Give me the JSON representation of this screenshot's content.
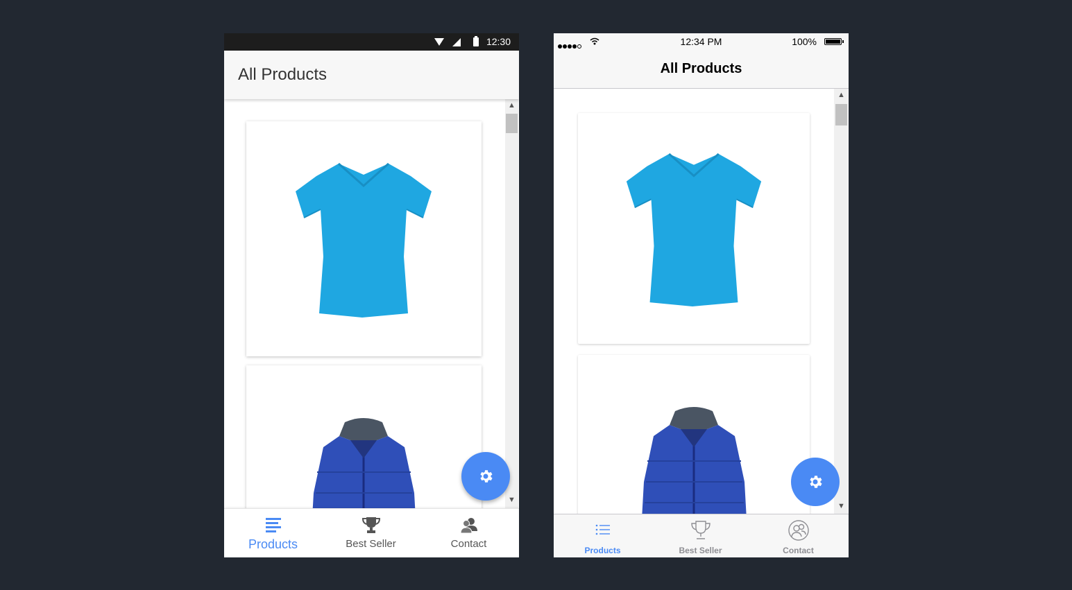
{
  "android": {
    "status": {
      "time": "12:30"
    },
    "appbar": {
      "title": "All Products"
    },
    "products": [
      {
        "name": "blue-tshirt"
      },
      {
        "name": "blue-jacket"
      }
    ],
    "fab": {
      "icon": "gear-icon"
    },
    "tabs": [
      {
        "label": "Products",
        "icon": "list-icon",
        "active": true
      },
      {
        "label": "Best Seller",
        "icon": "trophy-icon",
        "active": false
      },
      {
        "label": "Contact",
        "icon": "contacts-icon",
        "active": false
      }
    ]
  },
  "ios": {
    "status": {
      "time": "12:34 PM",
      "battery": "100%"
    },
    "navbar": {
      "title": "All Products"
    },
    "products": [
      {
        "name": "blue-tshirt"
      },
      {
        "name": "blue-jacket"
      }
    ],
    "fab": {
      "icon": "gear-icon"
    },
    "tabs": [
      {
        "label": "Products",
        "icon": "list-icon",
        "active": true
      },
      {
        "label": "Best Seller",
        "icon": "trophy-icon",
        "active": false
      },
      {
        "label": "Contact",
        "icon": "contacts-icon",
        "active": false
      }
    ]
  },
  "colors": {
    "accent": "#4a8af4",
    "background": "#222831",
    "shirt": "#1fa7e1",
    "jacket": "#2f4fb8"
  }
}
